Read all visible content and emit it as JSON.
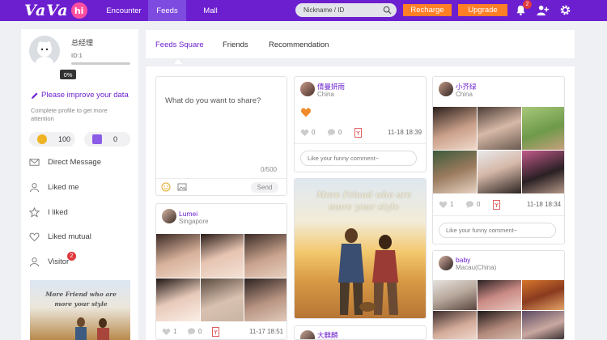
{
  "header": {
    "logo_text": "VaVa",
    "logo_suffix": "hi",
    "nav": [
      {
        "label": "Encounter",
        "active": false
      },
      {
        "label": "Feeds",
        "active": true
      },
      {
        "label": "Mall",
        "active": false
      }
    ],
    "search_placeholder": "Nickname / ID",
    "recharge_label": "Recharge",
    "upgrade_label": "Upgrade",
    "notification_count": "2",
    "colors": {
      "bar": "#6c1fcf",
      "active_tab": "#7e4be0",
      "orange": "#ff7f27"
    }
  },
  "profile": {
    "name": "总经理",
    "id_label": "ID:1",
    "completion": 0,
    "completion_label": "0%",
    "improve_label": "Please improve your data",
    "improve_hint": "Complete profile to get more attention",
    "coins": "100",
    "points": "0"
  },
  "side_menu": [
    {
      "label": "Direct Message",
      "icon": "mail-icon"
    },
    {
      "label": "Liked me",
      "icon": "person-icon"
    },
    {
      "label": "I liked",
      "icon": "star-icon"
    },
    {
      "label": "Liked mutual",
      "icon": "heart-icon"
    },
    {
      "label": "Visitor",
      "icon": "person-icon",
      "badge": "2"
    }
  ],
  "promo": {
    "text": "More Friend who are more your style"
  },
  "tabs": [
    {
      "label": "Feeds Square",
      "active": true
    },
    {
      "label": "Friends",
      "active": false
    },
    {
      "label": "Recommendation",
      "active": false
    }
  ],
  "composer": {
    "prompt": "What do you want to share?",
    "count": "0/500",
    "send_label": "Send"
  },
  "posts": [
    {
      "name": "Lumei",
      "location": "Singapore",
      "likes": "1",
      "comments": "0",
      "time": "11-17 18:51"
    },
    {
      "name": "倩曼妍雨",
      "location": "China",
      "likes": "0",
      "comments": "0",
      "time": "11-18 18:39",
      "comment_placeholder": "Like your funny comment~"
    },
    {
      "name": "大麒麟",
      "location": ""
    },
    {
      "name": "小芥绿",
      "location": "China",
      "likes": "1",
      "comments": "0",
      "time": "11-18 18:34",
      "comment_placeholder": "Like your funny comment~"
    },
    {
      "name": "baby",
      "location": "Macau(China)"
    }
  ],
  "banner": {
    "text": "More Friend who are more your style"
  }
}
